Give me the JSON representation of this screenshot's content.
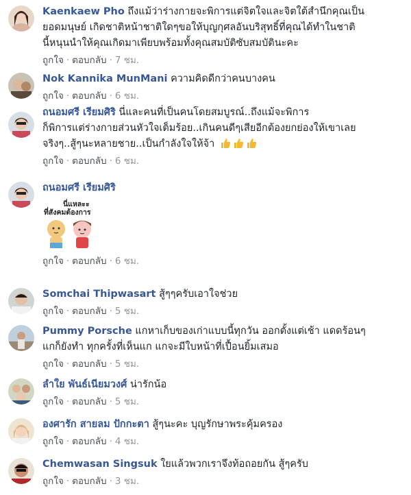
{
  "ui": {
    "like": "ถูกใจ",
    "reply": "ตอบกลับ",
    "dot": "·"
  },
  "comments": [
    {
      "name": "Kaenkaew Pho",
      "lines": [
        "ถึงแม้ว่าร่างกายจะพิการแต่จิตใจและจิตใต้สำนึกคุณเป็น",
        "ยอดมนุษย์ เกิดชาติหน้าชาติใดๆขอให้บุญกุศลอันบริสุทธิ์ที่คุณได้ทำในชาติ",
        "นี้หนุนนำให้คุณเกิดมาเพียบพร้อมทั้งคุณสมบัติซับสมบัตินะคะ"
      ],
      "time": "7 ชม."
    },
    {
      "name": "Nok Kannika MunMani",
      "lines": [
        "ความคิดดีกว่าคนบางคน"
      ],
      "time": "6 ชม."
    },
    {
      "name": "ถนอมศรี เรียมศิริ",
      "lines": [
        "นี่และคนที่เป็นคนโดยสมบูรณ์..ถึงแม้จะพิการ",
        "ก็พิการแต่ร่างกายส่วนหัวใจเต็มร้อย..เกินคนดีๆเสียอีกต้องยกย่องให้เขาเลย",
        "จริงๆ..สู้ๆนะหลายชาย..เป็นกำลังใจให้จ้า"
      ],
      "time": "6 ชม."
    },
    {
      "name": "ถนอมศรี เรียมศิริ",
      "lines": [],
      "sticker_text": [
        "นี่แหละะ",
        "ที่สังคมต้องการ"
      ],
      "time": "6 ชม."
    },
    {
      "name": "Somchai Thipwasart",
      "lines": [
        "สู้ๆๆครับเอาใจช่วย"
      ],
      "time": "5 ชม."
    },
    {
      "name": "Pummy Porsche",
      "lines": [
        "แกหาเก็บของเก่าแบบนี้ทุกวัน ออกตั้งแต่เช้า แดดร้อนๆ",
        "แกก็ยังทำ ทุกครั้งที่เห็นแก แกจะมีใบหน้าที่เปื้อนยิ้มเสมอ"
      ],
      "time": "5 ชม."
    },
    {
      "name": "ลำใย พันธ์เนียมวงศ์",
      "lines": [
        "น่ารักน้อ"
      ],
      "time": "5 ชม."
    },
    {
      "name": "องศารัก สายลม ปักกะตา",
      "lines": [
        "สู้ๆนะคะ บุญรักษาพระคุ้มครอง"
      ],
      "time": "4 ชม."
    },
    {
      "name": "Chemwasan Singsuk",
      "lines": [
        "ใยแล้วพวกเราจึงท้อถอยกัน สู้ๆครับ"
      ],
      "time": "3 ชม."
    }
  ]
}
